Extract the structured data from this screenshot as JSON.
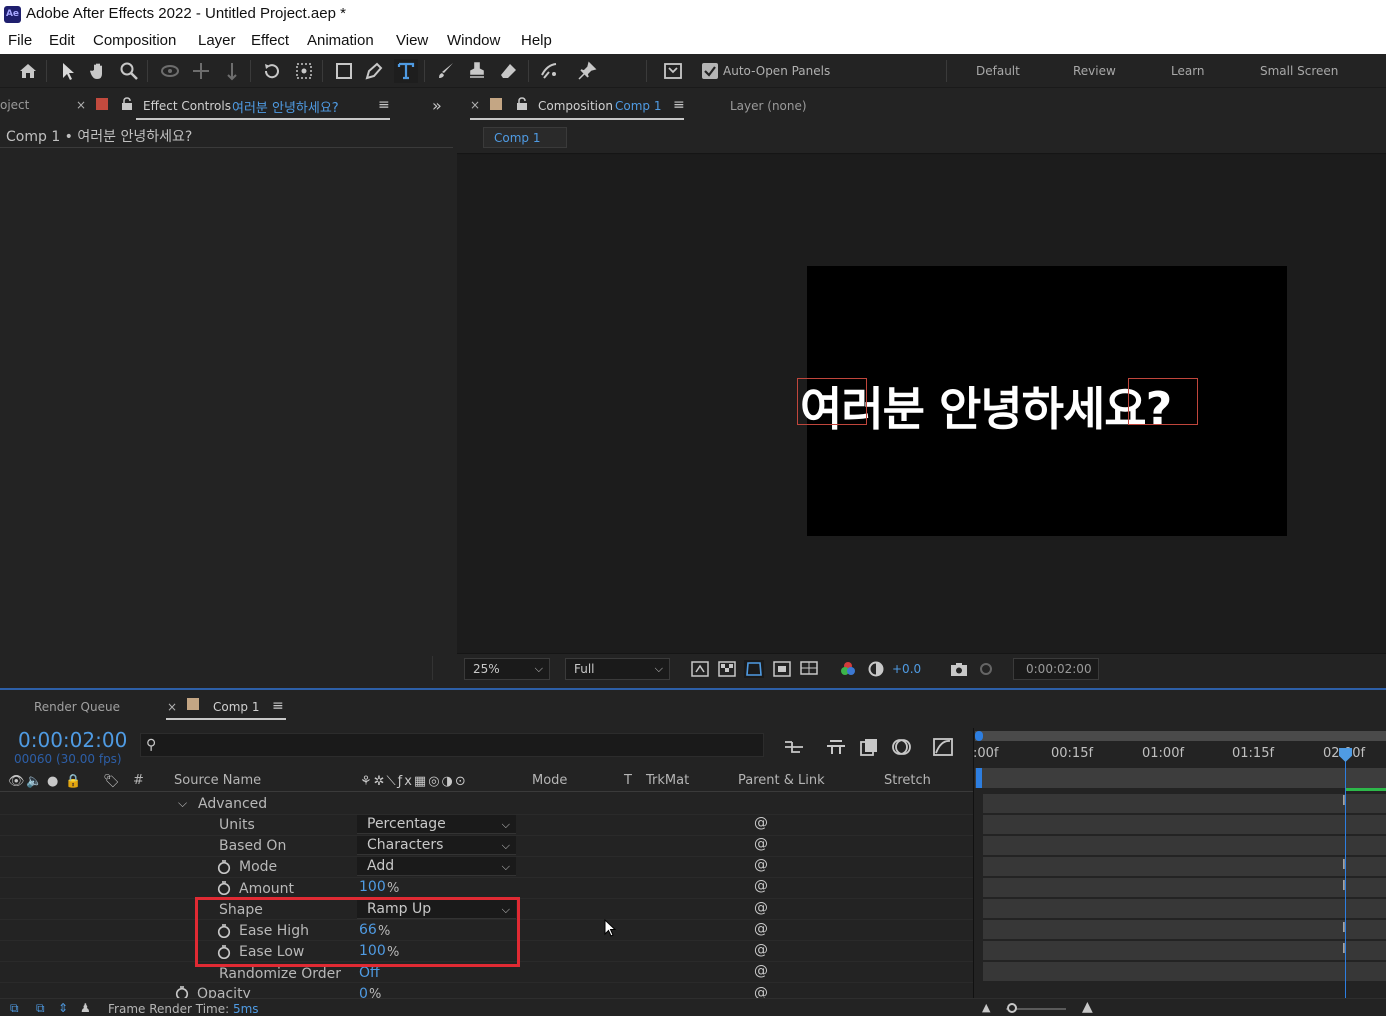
{
  "app": {
    "logo": "Ae",
    "title": "Adobe After Effects 2022 - Untitled Project.aep *"
  },
  "menu": [
    "File",
    "Edit",
    "Composition",
    "Layer",
    "Effect",
    "Animation",
    "View",
    "Window",
    "Help"
  ],
  "toolbar": {
    "auto_open_label": "Auto-Open Panels",
    "auto_open_checked": true,
    "workspaces": [
      "Default",
      "Review",
      "Learn",
      "Small Screen"
    ]
  },
  "effect_controls": {
    "project_tab": "oject",
    "tab_label": "Effect Controls",
    "tab_layer": "여러분 안녕하세요?",
    "header": "Comp 1 • 여러분 안녕하세요?"
  },
  "composition": {
    "tab_label": "Composition",
    "tab_comp": "Comp 1",
    "layer_tab": "Layer (none)",
    "breadcrumb": "Comp 1",
    "canvas_text": "여러분 안녕하세요?",
    "zoom": "25%",
    "resolution": "Full",
    "exposure": "+0.0",
    "timecode": "0:00:02:00"
  },
  "timeline": {
    "render_queue_tab": "Render Queue",
    "tab_label": "Comp 1",
    "timecode": "0:00:02:00",
    "frames": "00060 (30.00 fps)",
    "columns": {
      "hash": "#",
      "source_name": "Source Name",
      "mode": "Mode",
      "t": "T",
      "trkmat": "TrkMat",
      "parent": "Parent & Link",
      "stretch": "Stretch"
    },
    "ruler_labels": [
      ":00f",
      "00:15f",
      "01:00f",
      "01:15f",
      "02:00f"
    ],
    "properties": {
      "advanced": "Advanced",
      "units": {
        "name": "Units",
        "value": "Percentage"
      },
      "based_on": {
        "name": "Based On",
        "value": "Characters"
      },
      "mode": {
        "name": "Mode",
        "value": "Add"
      },
      "amount": {
        "name": "Amount",
        "value": "100",
        "unit": "%"
      },
      "shape": {
        "name": "Shape",
        "value": "Ramp Up"
      },
      "ease_high": {
        "name": "Ease High",
        "value": "66",
        "unit": "%"
      },
      "ease_low": {
        "name": "Ease Low",
        "value": "100",
        "unit": "%"
      },
      "randomize": {
        "name": "Randomize Order",
        "value": "Off"
      },
      "opacity": {
        "name": "Opacity",
        "value": "0",
        "unit": "%"
      }
    }
  },
  "status": {
    "label": "Frame Render Time:",
    "value": "5ms"
  },
  "colors": {
    "accent_blue": "#4f9be3",
    "highlight_red": "#e02a33",
    "text_bounds": "#c0463c"
  }
}
